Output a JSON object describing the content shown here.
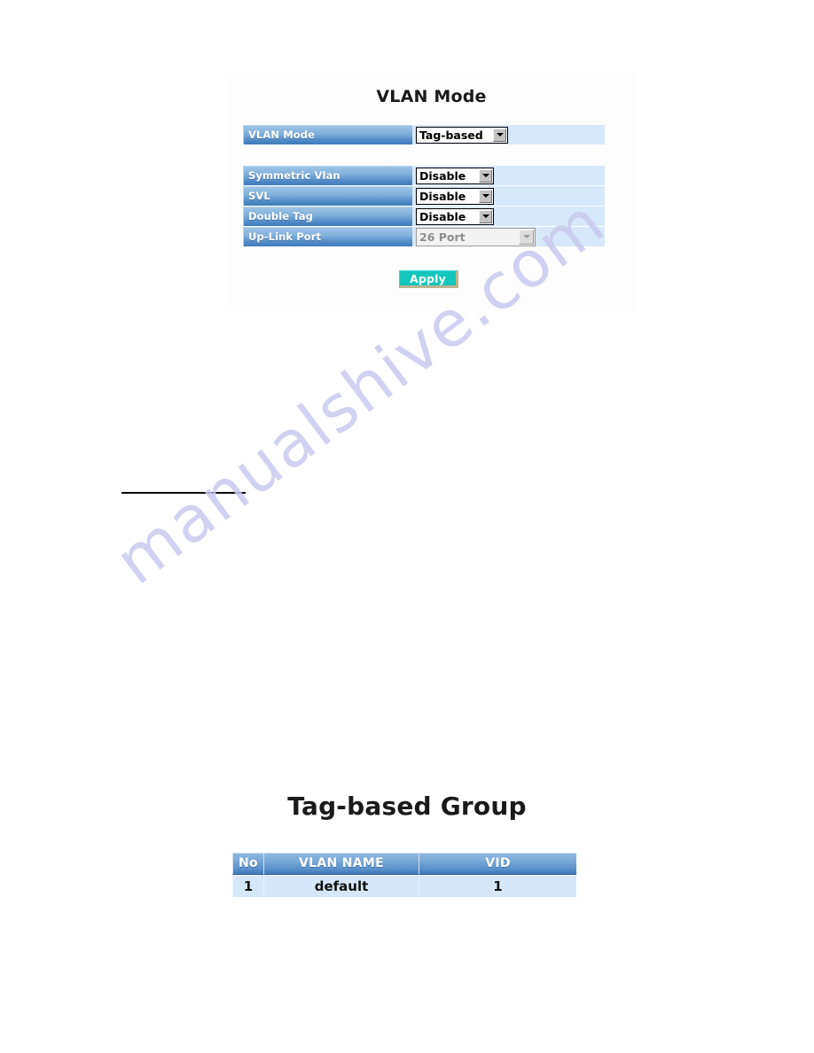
{
  "page": {
    "background_color": "#ffffff",
    "watermark_text": "manualshive.com",
    "watermark_color": "#c9c9ee"
  },
  "vlan_mode_panel": {
    "title": "VLAN Mode",
    "panel_background": "#fdfdfd",
    "label_color": "#ffffff",
    "row_background": "#d7e8fb",
    "primary_group": [
      {
        "label": "VLAN Mode",
        "control": "select",
        "value": "Tag-based",
        "disabled": false
      }
    ],
    "secondary_group": [
      {
        "label": "Symmetric Vlan",
        "control": "select",
        "value": "Disable",
        "disabled": false
      },
      {
        "label": "SVL",
        "control": "select",
        "value": "Disable",
        "disabled": false
      },
      {
        "label": "Double Tag",
        "control": "select",
        "value": "Disable",
        "disabled": false
      },
      {
        "label": "Up-Link Port",
        "control": "select",
        "value": "26 Port",
        "disabled": true
      }
    ],
    "apply_button": {
      "label": "Apply",
      "background_color": "#14c6bb",
      "text_color": "#ffffff",
      "border_color": "#bdb48d"
    }
  },
  "tag_based_group": {
    "title": "Tag-based Group",
    "header_background": "#5c93ca",
    "row_background": "#d6e7fa",
    "columns": [
      "No",
      "VLAN NAME",
      "VID"
    ],
    "rows": [
      {
        "no": "1",
        "vlan_name": "default",
        "vid": "1"
      }
    ]
  }
}
